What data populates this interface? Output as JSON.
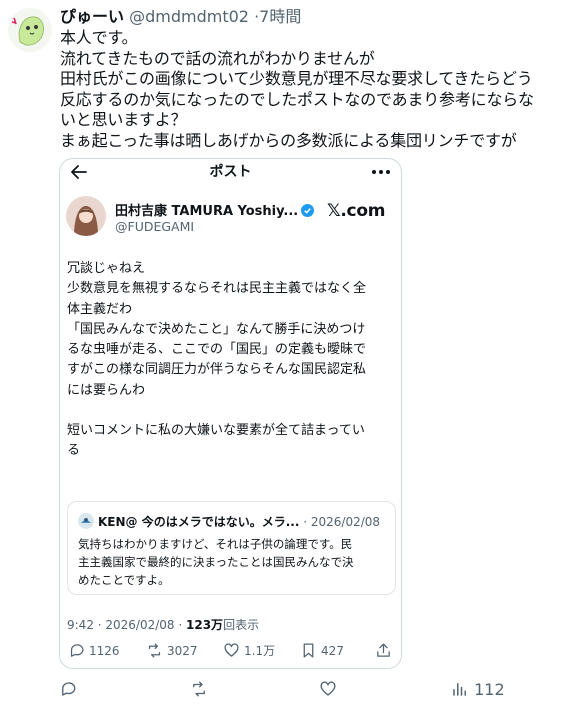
{
  "post": {
    "display_name": "ぴゅーい",
    "handle": "@dmdmdmt02",
    "separator": "·",
    "time": "7時間",
    "lines": [
      "本人です。",
      "流れてきたもので話の流れがわかりませんが",
      "田村氏がこの画像について少数意見が理不尽な要求してきたらどう",
      "反応するのか気になったのでしたポストなのであまり参考にならな",
      "いと思いますよ？",
      "まぁ起こった事は晒しあげからの多数派による集団リンチですが"
    ]
  },
  "screenshot": {
    "nav_title": "ポスト",
    "name": "田村吉康 TAMURA Yoshiy...",
    "handle": "@FUDEGAMI",
    "logo_text": "𝕏.com",
    "body_lines": [
      "冗談じゃねえ",
      "少数意見を無視するならそれは民主主義ではなく全",
      "体主義だわ",
      "「国民みんなで決めたこと」なんて勝手に決めつけ",
      "るな虫唾が走る、ここでの「国民」の定義も曖昧で",
      "すがこの様な同調圧力が伴うならそんな国民認定私",
      "には要らんわ",
      "",
      "短いコメントに私の大嫌いな要素が全て詰まってい",
      "る"
    ],
    "quoted": {
      "name": "KEN@ 今のはメラではない。メラ...",
      "date": "· 2026/02/08",
      "lines": [
        "気持ちはわかりますけど、それは子供の論理です。民",
        "主主義国家で最終的に決まったことは国民みんなで決",
        "めたことですよ。"
      ]
    },
    "meta": {
      "time": "9:42 · 2026/02/08 · ",
      "views": "123万",
      "views_label": "回表示"
    },
    "stats": {
      "replies": "1126",
      "reposts": "3027",
      "likes": "1.1万",
      "bookmarks": "427"
    }
  },
  "actions": {
    "views": "112"
  },
  "colors": {
    "text": "#0f1419",
    "secondary": "#536471",
    "border": "#cfd9de",
    "verified": "#1d9bf0",
    "avatar_green": "#c8e89a"
  },
  "icons": [
    "reply-icon",
    "repost-icon",
    "like-icon",
    "bookmark-icon",
    "share-icon",
    "views-icon",
    "back-icon",
    "more-icon",
    "verified-icon"
  ]
}
